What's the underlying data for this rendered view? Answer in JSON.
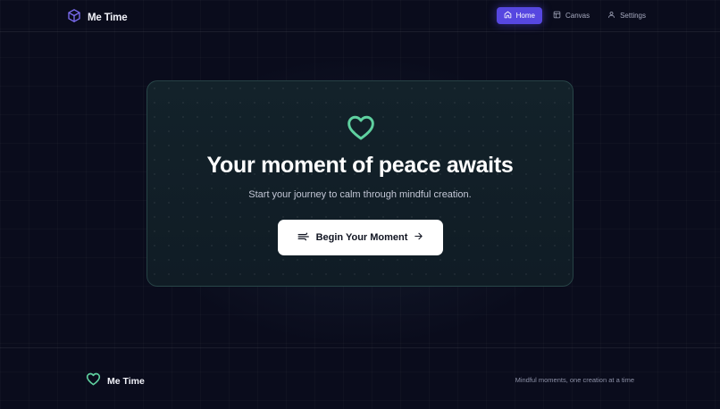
{
  "brand": {
    "name": "Me Time",
    "icon": "cube-icon",
    "accent": "#7b6cf0"
  },
  "nav": {
    "items": [
      {
        "label": "Home",
        "icon": "home-icon",
        "active": true
      },
      {
        "label": "Canvas",
        "icon": "layout-icon",
        "active": false
      },
      {
        "label": "Settings",
        "icon": "user-icon",
        "active": false
      }
    ]
  },
  "hero": {
    "icon": "heart-icon",
    "title": "Your moment of peace awaits",
    "subtitle": "Start your journey to calm through mindful creation.",
    "cta_label": "Begin Your Moment",
    "cta_icon": "wind-icon",
    "cta_trailing_icon": "arrow-right-icon",
    "accent": "#5fd1a0"
  },
  "footer": {
    "brand_name": "Me Time",
    "icon": "heart-icon",
    "tagline": "Mindful moments, one creation at a time"
  }
}
